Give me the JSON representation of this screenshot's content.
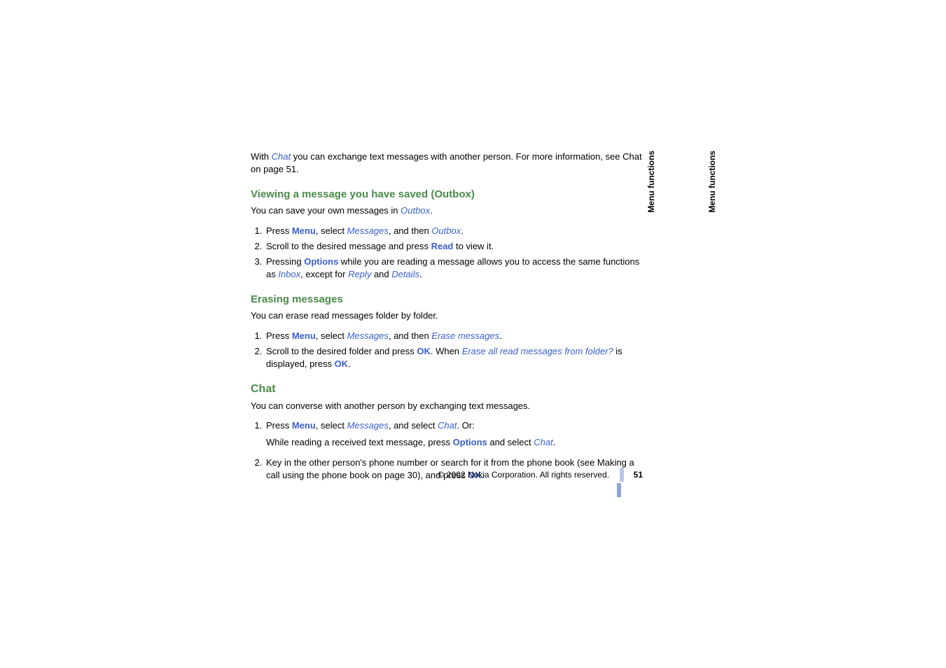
{
  "sideLabel": "Menu functions",
  "intro": {
    "prefix": "With ",
    "chat": "Chat",
    "rest": " you can exchange text messages with another person. For more information, see Chat on page 51."
  },
  "sections": {
    "outbox": {
      "title": "Viewing a message you have saved (Outbox)",
      "lead_prefix": "You can save your own messages in ",
      "lead_link": "Outbox",
      "lead_suffix": ".",
      "items": [
        {
          "pre": "Press ",
          "cmd1": "Menu",
          "mid1": ", select ",
          "link1": "Messages",
          "mid2": ", and then ",
          "link2": "Outbox",
          "suffix": "."
        },
        {
          "pre": "Scroll to the desired message and press ",
          "cmd1": "Read",
          "suffix": " to view it."
        },
        {
          "pre": "Pressing ",
          "cmd1": "Options",
          "mid1": " while you are reading a message allows you to access the same functions as ",
          "link1": "Inbox",
          "mid2": ", except for ",
          "link2": "Reply",
          "mid3": " and ",
          "link3": "Details",
          "suffix": "."
        }
      ]
    },
    "erase": {
      "title": "Erasing messages",
      "lead": "You can erase read messages folder by folder.",
      "items": [
        {
          "pre": "Press ",
          "cmd1": "Menu",
          "mid1": ", select ",
          "link1": "Messages",
          "mid2": ", and then ",
          "link2": "Erase messages",
          "suffix": "."
        },
        {
          "pre": "Scroll to the desired folder and press ",
          "cmd1": "OK",
          "mid1": ". When ",
          "link1": "Erase all read messages from folder?",
          "mid2": " is displayed, press ",
          "cmd2": "OK",
          "suffix": "."
        }
      ]
    },
    "chat": {
      "title": "Chat",
      "lead": "You can converse with another person by exchanging text messages.",
      "items": [
        {
          "pre": "Press ",
          "cmd1": "Menu",
          "mid1": ", select ",
          "link1": "Messages",
          "mid2": ", and select ",
          "link2": "Chat",
          "suffix": ". Or:",
          "sub_pre": "While reading a received text message, press ",
          "sub_cmd": "Options",
          "sub_mid": " and select ",
          "sub_link": "Chat",
          "sub_suffix": "."
        },
        {
          "pre": "Key in the other person's phone number or search for it from the phone book (see Making a call using the phone book on page 30), and press ",
          "cmd1": "OK",
          "suffix": "."
        }
      ]
    }
  },
  "footer": {
    "copyright_symbol": "©",
    "text": "2002 Nokia Corporation. All rights reserved.",
    "page": "51"
  }
}
